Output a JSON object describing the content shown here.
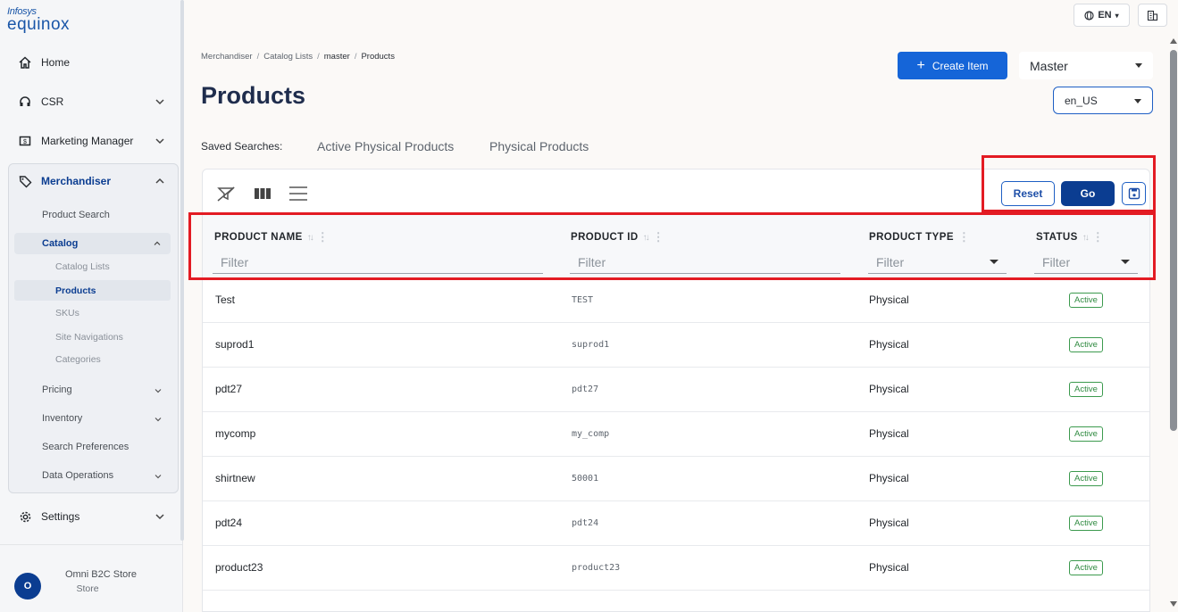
{
  "logo": {
    "line1": "Infosys",
    "line2": "equinox"
  },
  "sidebar": {
    "home": "Home",
    "csr": "CSR",
    "marketing": "Marketing Manager",
    "merchandiser": "Merchandiser",
    "product_search": "Product Search",
    "catalog": "Catalog",
    "catalog_lists": "Catalog Lists",
    "products": "Products",
    "skus": "SKUs",
    "site_navigations": "Site Navigations",
    "categories": "Categories",
    "pricing": "Pricing",
    "inventory": "Inventory",
    "search_preferences": "Search Preferences",
    "data_operations": "Data Operations",
    "settings": "Settings"
  },
  "user": {
    "initial": "O",
    "store_name": "Omni B2C Store",
    "store_label": "Store"
  },
  "topbar": {
    "language": "EN"
  },
  "breadcrumb": [
    "Merchandiser",
    "Catalog Lists",
    "master",
    "Products"
  ],
  "page_title": "Products",
  "create_button": "Create Item",
  "catalog_select": "Master",
  "locale_select": "en_US",
  "saved_searches": {
    "label": "Saved Searches:",
    "items": [
      "Active Physical Products",
      "Physical Products"
    ]
  },
  "toolbar": {
    "reset": "Reset",
    "go": "Go"
  },
  "columns": {
    "name": "PRODUCT NAME",
    "id": "PRODUCT ID",
    "type": "PRODUCT TYPE",
    "status": "STATUS",
    "filter_placeholder": "Filter"
  },
  "rows": [
    {
      "name": "Test",
      "id": "TEST",
      "type": "Physical",
      "status": "Active"
    },
    {
      "name": "suprod1",
      "id": "suprod1",
      "type": "Physical",
      "status": "Active"
    },
    {
      "name": "pdt27",
      "id": "pdt27",
      "type": "Physical",
      "status": "Active"
    },
    {
      "name": "mycomp",
      "id": "my_comp",
      "type": "Physical",
      "status": "Active"
    },
    {
      "name": "shirtnew",
      "id": "50001",
      "type": "Physical",
      "status": "Active"
    },
    {
      "name": "pdt24",
      "id": "pdt24",
      "type": "Physical",
      "status": "Active"
    },
    {
      "name": "product23",
      "id": "product23",
      "type": "Physical",
      "status": "Active"
    }
  ],
  "colors": {
    "primary": "#1565d8",
    "dark_primary": "#0b3d91",
    "highlight": "#e31b23",
    "active_green": "#2f8a40"
  }
}
